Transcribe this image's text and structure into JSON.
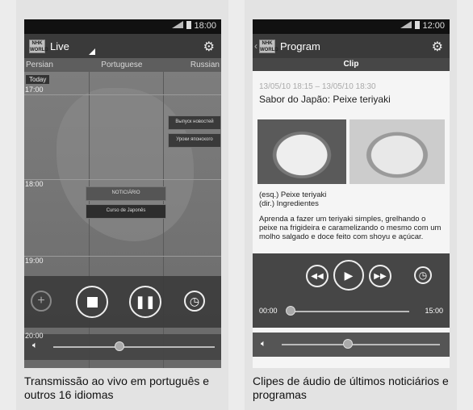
{
  "left": {
    "status_time": "18:00",
    "app_title": "Live",
    "languages": [
      "Persian",
      "Portuguese",
      "Russian"
    ],
    "today": "Today",
    "times": [
      "17:00",
      "18:00",
      "19:00",
      "20:00"
    ],
    "programs": [
      "NOTICIÁRIO",
      "Curso de Japonês",
      "Выпуск новостей",
      "Уроки японского"
    ],
    "caption": "Transmissão ao vivo em português e outros 16 idiomas"
  },
  "right": {
    "status_time": "12:00",
    "app_title": "Program",
    "subtitle": "Clip",
    "date": "13/05/10 18:15 – 13/05/10 18:30",
    "title": "Sabor do Japão: Peixe teriyaki",
    "image_caption": "(esq.) Peixe teriyaki\n(dir.) Ingredientes",
    "description": "Aprenda a fazer um teriyaki simples, grelhando o peixe na frigideira e caramelizando o mesmo com um molho salgado e doce feito com shoyu e açúcar.",
    "time_start": "00:00",
    "time_end": "15:00",
    "progress": 0.02,
    "caption": "Clipes de áudio de últimos noticiários e programas"
  },
  "icons": {
    "settings": "gear-icon",
    "volume": "speaker-icon",
    "logo": "nhk-world-logo"
  }
}
